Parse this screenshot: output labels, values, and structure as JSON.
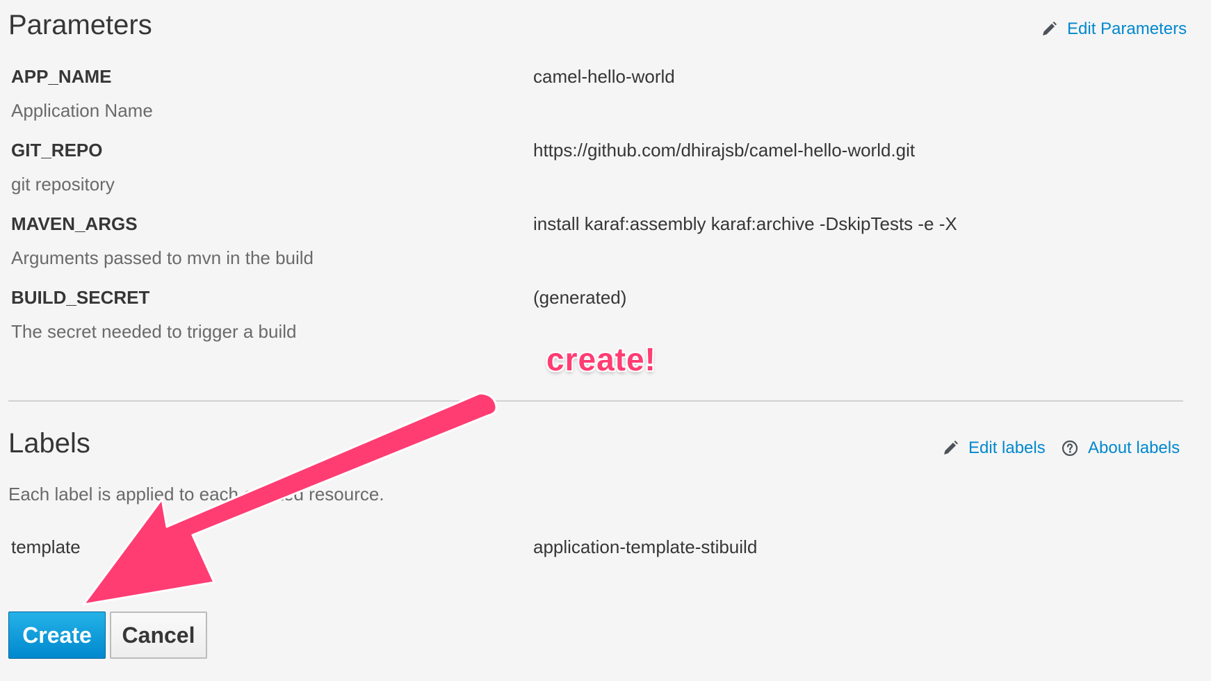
{
  "parameters": {
    "title": "Parameters",
    "edit_label": "Edit Parameters",
    "items": [
      {
        "name": "APP_NAME",
        "description": "Application Name",
        "value": "camel-hello-world"
      },
      {
        "name": "GIT_REPO",
        "description": "git repository",
        "value": "https://github.com/dhirajsb/camel-hello-world.git"
      },
      {
        "name": "MAVEN_ARGS",
        "description": "Arguments passed to mvn in the build",
        "value": "install karaf:assembly karaf:archive -DskipTests -e -X"
      },
      {
        "name": "BUILD_SECRET",
        "description": "The secret needed to trigger a build",
        "value": "(generated)"
      }
    ]
  },
  "labels": {
    "title": "Labels",
    "edit_label": "Edit labels",
    "about_label": "About labels",
    "help_text": "Each label is applied to each created resource.",
    "items": [
      {
        "key": "template",
        "value": "application-template-stibuild"
      }
    ]
  },
  "buttons": {
    "create_label": "Create",
    "cancel_label": "Cancel"
  },
  "annotation": {
    "text": "create!"
  },
  "colors": {
    "link": "#0088ce",
    "primary_button": "#0088ce",
    "annotation": "#ff3d73"
  },
  "icons": {
    "edit": "pencil-icon",
    "help": "question-circle-icon"
  }
}
